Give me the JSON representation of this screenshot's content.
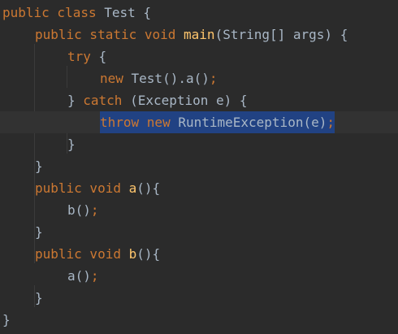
{
  "editor": {
    "lines": [
      {
        "parts": [
          {
            "text": "public class ",
            "cls": "kw"
          },
          {
            "text": "Test {",
            "cls": "plain"
          }
        ]
      },
      {
        "parts": [
          {
            "text": "public static void ",
            "cls": "kw"
          },
          {
            "text": "main",
            "cls": "fn"
          },
          {
            "text": "(String[] args) {",
            "cls": "plain"
          }
        ]
      },
      {
        "parts": [
          {
            "text": "try ",
            "cls": "kw"
          },
          {
            "text": "{",
            "cls": "plain"
          }
        ]
      },
      {
        "parts": [
          {
            "text": "new ",
            "cls": "kw"
          },
          {
            "text": "Test().a()",
            "cls": "plain"
          },
          {
            "text": ";",
            "cls": "punct"
          }
        ]
      },
      {
        "parts": [
          {
            "text": "} ",
            "cls": "plain"
          },
          {
            "text": "catch ",
            "cls": "kw"
          },
          {
            "text": "(Exception e) {",
            "cls": "plain"
          }
        ]
      },
      {
        "parts": [
          {
            "text": "throw new ",
            "cls": "kw"
          },
          {
            "text": "RuntimeException(e)",
            "cls": "plain"
          },
          {
            "text": ";",
            "cls": "punct"
          }
        ]
      },
      {
        "parts": [
          {
            "text": "}",
            "cls": "plain"
          }
        ]
      },
      {
        "parts": [
          {
            "text": "}",
            "cls": "plain"
          }
        ]
      },
      {
        "parts": [
          {
            "text": "public void ",
            "cls": "kw"
          },
          {
            "text": "a",
            "cls": "fn"
          },
          {
            "text": "(){",
            "cls": "plain"
          }
        ]
      },
      {
        "parts": [
          {
            "text": "b()",
            "cls": "plain"
          },
          {
            "text": ";",
            "cls": "punct"
          }
        ]
      },
      {
        "parts": [
          {
            "text": "}",
            "cls": "plain"
          }
        ]
      },
      {
        "parts": [
          {
            "text": "public void ",
            "cls": "kw"
          },
          {
            "text": "b",
            "cls": "fn"
          },
          {
            "text": "(){",
            "cls": "plain"
          }
        ]
      },
      {
        "parts": [
          {
            "text": "a()",
            "cls": "plain"
          },
          {
            "text": ";",
            "cls": "punct"
          }
        ]
      },
      {
        "parts": [
          {
            "text": "}",
            "cls": "plain"
          }
        ]
      },
      {
        "parts": [
          {
            "text": "}",
            "cls": "plain"
          }
        ]
      }
    ],
    "current_line": 5,
    "selected_line": 5
  },
  "colors": {
    "background": "#2b2b2b",
    "keyword": "#cc7832",
    "text": "#a9b7c6",
    "function": "#ffc66d",
    "selection": "#214283",
    "current_line": "#323232"
  }
}
